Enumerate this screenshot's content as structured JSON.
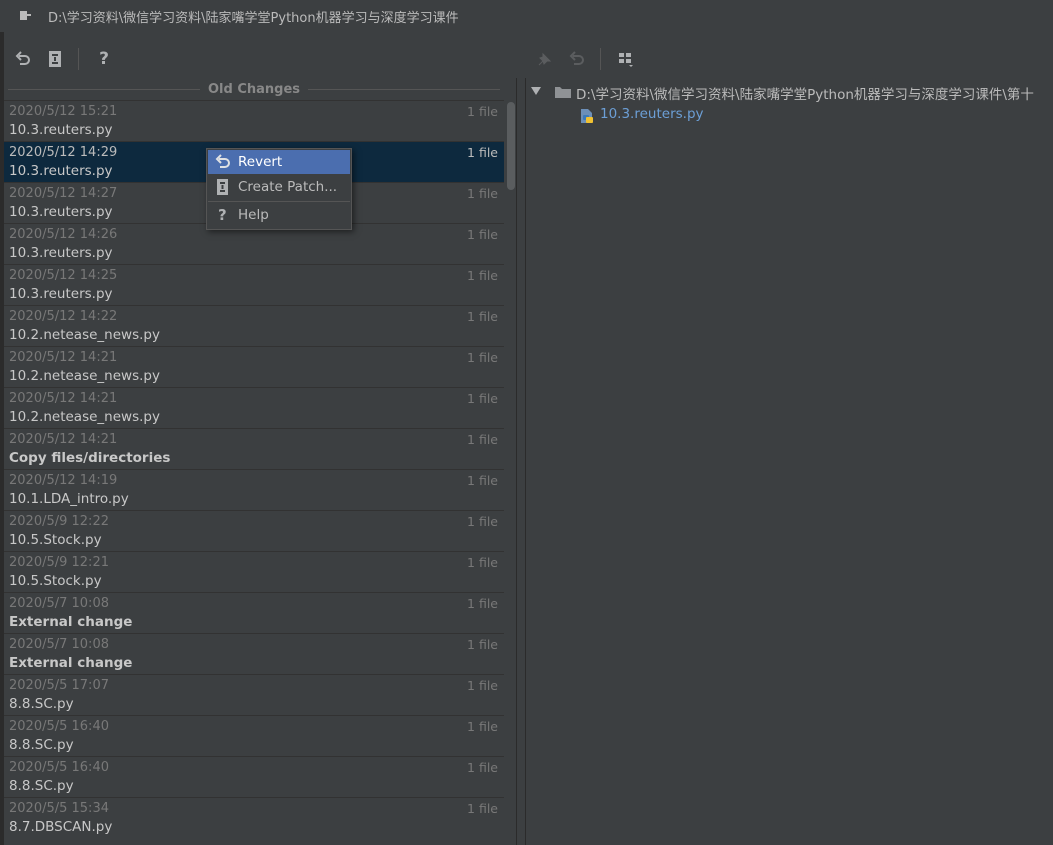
{
  "window": {
    "title": "D:\\学习资料\\微信学习资料\\陆家嘴学堂Python机器学习与深度学习课件"
  },
  "toolbar": {
    "left": [
      {
        "icon": "revert-icon"
      },
      {
        "icon": "create-patch-icon"
      },
      {
        "icon": "help-icon",
        "label": "?"
      }
    ],
    "right": [
      {
        "icon": "pin-icon"
      },
      {
        "icon": "revert-icon"
      },
      {
        "icon": "group-by-icon"
      }
    ]
  },
  "history": {
    "section_label": "Old Changes",
    "rows": [
      {
        "date": "2020/5/12 15:21",
        "files": "1 file",
        "name": "10.3.reuters.py",
        "bold": false
      },
      {
        "date": "2020/5/12 14:29",
        "files": "1 file",
        "name": "10.3.reuters.py",
        "bold": false,
        "selected": true
      },
      {
        "date": "2020/5/12 14:27",
        "files": "1 file",
        "name": "10.3.reuters.py",
        "bold": false
      },
      {
        "date": "2020/5/12 14:26",
        "files": "1 file",
        "name": "10.3.reuters.py",
        "bold": false
      },
      {
        "date": "2020/5/12 14:25",
        "files": "1 file",
        "name": "10.3.reuters.py",
        "bold": false
      },
      {
        "date": "2020/5/12 14:22",
        "files": "1 file",
        "name": "10.2.netease_news.py",
        "bold": false
      },
      {
        "date": "2020/5/12 14:21",
        "files": "1 file",
        "name": "10.2.netease_news.py",
        "bold": false
      },
      {
        "date": "2020/5/12 14:21",
        "files": "1 file",
        "name": "10.2.netease_news.py",
        "bold": false
      },
      {
        "date": "2020/5/12 14:21",
        "files": "1 file",
        "name": "Copy files/directories",
        "bold": true
      },
      {
        "date": "2020/5/12 14:19",
        "files": "1 file",
        "name": "10.1.LDA_intro.py",
        "bold": false
      },
      {
        "date": "2020/5/9 12:22",
        "files": "1 file",
        "name": "10.5.Stock.py",
        "bold": false
      },
      {
        "date": "2020/5/9 12:21",
        "files": "1 file",
        "name": "10.5.Stock.py",
        "bold": false
      },
      {
        "date": "2020/5/7 10:08",
        "files": "1 file",
        "name": "External change",
        "bold": true
      },
      {
        "date": "2020/5/7 10:08",
        "files": "1 file",
        "name": "External change",
        "bold": true
      },
      {
        "date": "2020/5/5 17:07",
        "files": "1 file",
        "name": "8.8.SC.py",
        "bold": false
      },
      {
        "date": "2020/5/5 16:40",
        "files": "1 file",
        "name": "8.8.SC.py",
        "bold": false
      },
      {
        "date": "2020/5/5 16:40",
        "files": "1 file",
        "name": "8.8.SC.py",
        "bold": false
      },
      {
        "date": "2020/5/5 15:34",
        "files": "1 file",
        "name": "8.7.DBSCAN.py",
        "bold": false
      }
    ]
  },
  "context_menu": {
    "items": [
      {
        "label": "Revert",
        "icon": "revert-icon",
        "highlighted": true
      },
      {
        "label": "Create Patch...",
        "icon": "create-patch-icon"
      },
      {
        "label": "Help",
        "icon": "help-icon"
      }
    ]
  },
  "changes_tree": {
    "root_path": "D:\\学习资料\\微信学习资料\\陆家嘴学堂Python机器学习与深度学习课件\\第十",
    "files": [
      {
        "name": "10.3.reuters.py",
        "icon": "python-file-icon"
      }
    ]
  },
  "colors": {
    "background": "#3c3f41",
    "selection": "#0d293e",
    "menu_highlight": "#4b6eaf",
    "file_link": "#6c9fd6"
  }
}
